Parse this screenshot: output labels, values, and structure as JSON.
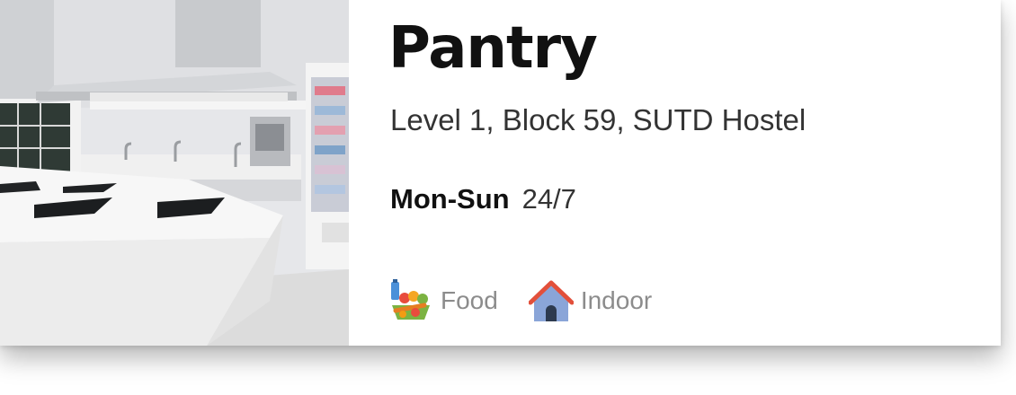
{
  "place": {
    "title": "Pantry",
    "address": "Level 1, Block 59, SUTD Hostel",
    "hours": {
      "days": "Mon-Sun",
      "time": "24/7"
    },
    "tags": [
      {
        "label": "Food",
        "icon": "food-icon"
      },
      {
        "label": "Indoor",
        "icon": "house-icon"
      }
    ]
  },
  "colors": {
    "title": "#111111",
    "tag_text": "#8c8c8c",
    "roof": "#e2503b",
    "house": "#8aa5d8"
  }
}
